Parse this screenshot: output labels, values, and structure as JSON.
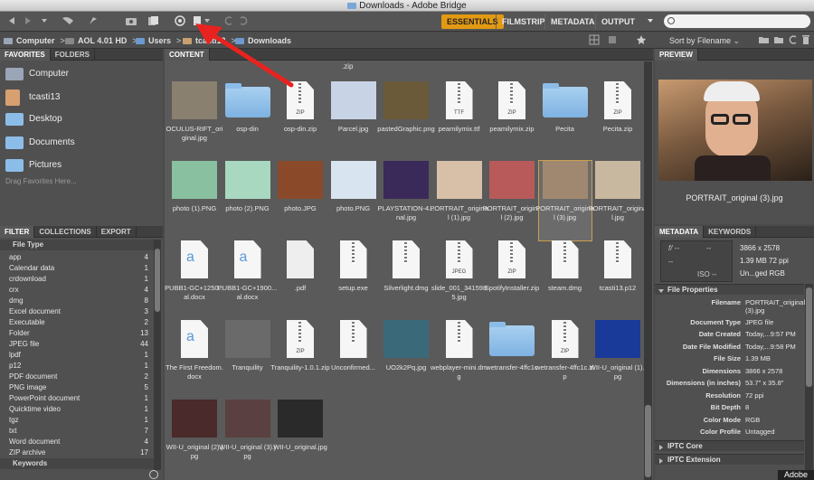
{
  "window": {
    "title": "Downloads - Adobe Bridge"
  },
  "workspaces": [
    {
      "label": "ESSENTIALS",
      "active": true
    },
    {
      "label": "FILMSTRIP",
      "active": false
    },
    {
      "label": "METADATA",
      "active": false
    },
    {
      "label": "OUTPUT",
      "active": false
    }
  ],
  "search": {
    "placeholder": ""
  },
  "breadcrumb": [
    "Computer",
    "AOL 4.01 HD",
    "Users",
    "tcasti13",
    "Downloads"
  ],
  "sort": {
    "label": "Sort by Filename"
  },
  "left_tabs": {
    "favorites": "FAVORITES",
    "folders": "FOLDERS"
  },
  "favorites": [
    {
      "label": "Computer",
      "icon": "computer-icon"
    },
    {
      "label": "tcasti13",
      "icon": "home-icon"
    },
    {
      "label": "Desktop",
      "icon": "folder-icon"
    },
    {
      "label": "Documents",
      "icon": "folder-icon"
    },
    {
      "label": "Pictures",
      "icon": "folder-icon"
    }
  ],
  "favorites_hint": "Drag Favorites Here...",
  "filter_tabs": {
    "filter": "FILTER",
    "collections": "COLLECTIONS",
    "export": "EXPORT"
  },
  "filter_section": "File Type",
  "filter_items": [
    {
      "label": "app",
      "count": "4"
    },
    {
      "label": "Calendar data",
      "count": "1"
    },
    {
      "label": "crdownload",
      "count": "1"
    },
    {
      "label": "crx",
      "count": "4"
    },
    {
      "label": "dmg",
      "count": "8"
    },
    {
      "label": "Excel document",
      "count": "3"
    },
    {
      "label": "Executable",
      "count": "2"
    },
    {
      "label": "Folder",
      "count": "13"
    },
    {
      "label": "JPEG file",
      "count": "44"
    },
    {
      "label": "lpdf",
      "count": "1"
    },
    {
      "label": "p12",
      "count": "1"
    },
    {
      "label": "PDF document",
      "count": "2"
    },
    {
      "label": "PNG image",
      "count": "5"
    },
    {
      "label": "PowerPoint document",
      "count": "1"
    },
    {
      "label": "Quicktime video",
      "count": "1"
    },
    {
      "label": "tgz",
      "count": "1"
    },
    {
      "label": "txt",
      "count": "7"
    },
    {
      "label": "Word document",
      "count": "4"
    },
    {
      "label": "ZIP archive",
      "count": "17"
    }
  ],
  "filter_keywords": "Keywords",
  "content_tab": "CONTENT",
  "content_top_label": ".zip",
  "thumbs": [
    {
      "cap": "OCULUS-RIFT_original.jpg",
      "kind": "photo",
      "color": "#8a8070"
    },
    {
      "cap": "osp-din",
      "kind": "folder"
    },
    {
      "cap": "osp-din.zip",
      "kind": "zip",
      "ext": "ZIP"
    },
    {
      "cap": "Parcel.jpg",
      "kind": "photo",
      "color": "#c8d4e6"
    },
    {
      "cap": "pastedGraphic.png",
      "kind": "photo",
      "color": "#6a5a3a"
    },
    {
      "cap": "peamilymix.ttf",
      "kind": "zip",
      "ext": "TTF"
    },
    {
      "cap": "peamilymix.zip",
      "kind": "zip",
      "ext": "ZIP"
    },
    {
      "cap": "Pecita",
      "kind": "folder"
    },
    {
      "cap": "Pecita.zip",
      "kind": "zip",
      "ext": "ZIP"
    },
    {
      "cap": "photo (1).PNG",
      "kind": "photo",
      "color": "#88c0a0"
    },
    {
      "cap": "photo (2).PNG",
      "kind": "photo",
      "color": "#a8d8c0"
    },
    {
      "cap": "photo.JPG",
      "kind": "photo",
      "color": "#8a4a2a"
    },
    {
      "cap": "photo.PNG",
      "kind": "photo",
      "color": "#d8e4f0"
    },
    {
      "cap": "PLAYSTATION-4...nal.jpg",
      "kind": "photo",
      "color": "#3a2a5a"
    },
    {
      "cap": "PORTRAIT_original (1).jpg",
      "kind": "photo",
      "color": "#d8c0a8"
    },
    {
      "cap": "PORTRAIT_original (2).jpg",
      "kind": "photo",
      "color": "#b85a5a"
    },
    {
      "cap": "PORTRAIT_original (3).jpg",
      "kind": "photo",
      "color": "#a08870",
      "selected": true
    },
    {
      "cap": "PORTRAIT_original.jpg",
      "kind": "photo",
      "color": "#c8b8a0"
    },
    {
      "cap": "PUBB1-GC+1250...al.docx",
      "kind": "docx"
    },
    {
      "cap": "PUBB1-GC+1900...al.docx",
      "kind": "docx"
    },
    {
      "cap": ".pdf",
      "kind": "doc"
    },
    {
      "cap": "setup.exe",
      "kind": "zip",
      "ext": ""
    },
    {
      "cap": "Silverlight.dmg",
      "kind": "zip",
      "ext": ""
    },
    {
      "cap": "slide_001_3415985.jpg",
      "kind": "zip",
      "ext": "JPEG"
    },
    {
      "cap": "SpotifyInstaller.zip",
      "kind": "zip",
      "ext": "ZIP"
    },
    {
      "cap": "steam.dmg",
      "kind": "zip",
      "ext": ""
    },
    {
      "cap": "tcasti13.p12",
      "kind": "zip",
      "ext": ""
    },
    {
      "cap": "The First Freedom.docx",
      "kind": "docx"
    },
    {
      "cap": "Tranquility",
      "kind": "photo",
      "color": "#6a6a6a"
    },
    {
      "cap": "Tranquility-1.0.1.zip",
      "kind": "zip",
      "ext": "ZIP"
    },
    {
      "cap": "Unconfirmed...",
      "kind": "zip",
      "ext": ""
    },
    {
      "cap": "UO2k2Pq.jpg",
      "kind": "photo",
      "color": "#3a6a7a"
    },
    {
      "cap": "webplayer-mini.dmg",
      "kind": "zip",
      "ext": ""
    },
    {
      "cap": "wetransfer-4ffc1c",
      "kind": "folder"
    },
    {
      "cap": "wetransfer-4ffc1c.zip",
      "kind": "zip",
      "ext": "ZIP"
    },
    {
      "cap": "WII-U_original (1).jpg",
      "kind": "photo",
      "color": "#1a3a9a"
    },
    {
      "cap": "WII-U_original (2).jpg",
      "kind": "photo",
      "color": "#4a2a2a"
    },
    {
      "cap": "WII-U_original (3).jpg",
      "kind": "photo",
      "color": "#5a4040"
    },
    {
      "cap": "WII-U_original.jpg",
      "kind": "photo",
      "color": "#2a2a2a"
    }
  ],
  "preview_tab": "PREVIEW",
  "preview_caption": "PORTRAIT_original (3).jpg",
  "meta_tabs": {
    "metadata": "METADATA",
    "keywords": "KEYWORDS"
  },
  "camera": {
    "f": "f/ --",
    "shutter": "--",
    "ev": "--",
    "iso": "ISO --",
    "dims": "3866 x 2578",
    "size": "1.39 MB  72 ppi",
    "color": "Un...ged  RGB"
  },
  "file_props_title": "File Properties",
  "file_props": [
    {
      "k": "Filename",
      "v": "PORTRAIT_original (3).jpg"
    },
    {
      "k": "Document Type",
      "v": "JPEG file"
    },
    {
      "k": "Date Created",
      "v": "Today,...9:57 PM"
    },
    {
      "k": "Date File Modified",
      "v": "Today,...9:58 PM"
    },
    {
      "k": "File Size",
      "v": "1.39 MB"
    },
    {
      "k": "Dimensions",
      "v": "3866 x 2578"
    },
    {
      "k": "Dimensions (in inches)",
      "v": "53.7\" x 35.8\""
    },
    {
      "k": "Resolution",
      "v": "72 ppi"
    },
    {
      "k": "Bit Depth",
      "v": "8"
    },
    {
      "k": "Color Mode",
      "v": "RGB"
    },
    {
      "k": "Color Profile",
      "v": "Untagged"
    }
  ],
  "iptc_core": "IPTC Core",
  "iptc_ext": "IPTC Extension",
  "watermark": "Adobe"
}
